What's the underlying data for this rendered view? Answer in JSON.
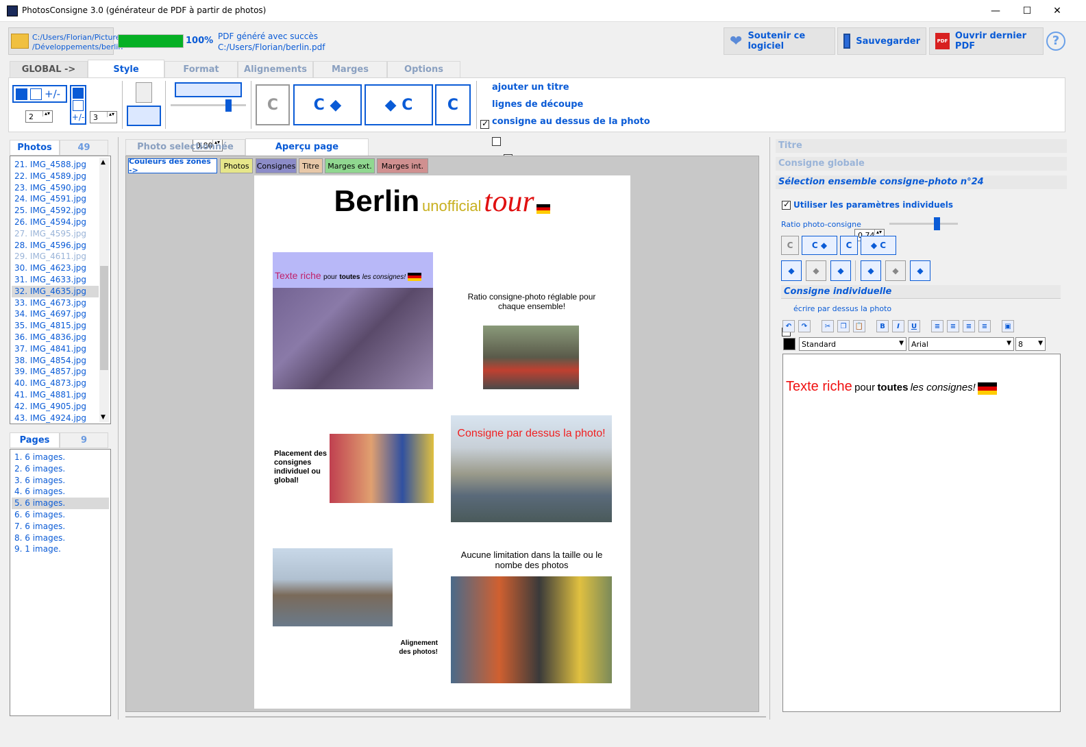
{
  "window": {
    "title": "PhotosConsigne 3.0 (générateur de PDF à partir de photos)",
    "min": "—",
    "max": "☐",
    "close": "✕"
  },
  "top": {
    "path1": "C:/Users/Florian/Pictures",
    "path2": "/Développements/berlin",
    "progress_value": 1.0,
    "progress_label": "100%",
    "status1": "PDF généré avec succès",
    "status2": "C:/Users/Florian/berlin.pdf",
    "support": "Soutenir ce logiciel",
    "save": "Sauvegarder",
    "open_pdf": "Ouvrir dernier PDF",
    "help": "?"
  },
  "tabs": {
    "global": "GLOBAL ->",
    "style": "Style",
    "format": "Format",
    "alignements": "Alignements",
    "marges": "Marges",
    "options": "Options"
  },
  "style": {
    "cols": "2",
    "rows": "3",
    "plusminus": "+/-",
    "ratio": "0,80",
    "chk_title": "ajouter un titre",
    "chk_cut": "lignes de découpe",
    "chk_above": "consigne au dessus de la photo",
    "chk_title_on": true,
    "chk_cut_on": false,
    "chk_above_on": false
  },
  "photos": {
    "tab": "Photos",
    "count": "49",
    "items": [
      "21. IMG_4588.jpg",
      "22. IMG_4589.jpg",
      "23. IMG_4590.jpg",
      "24. IMG_4591.jpg",
      "25. IMG_4592.jpg",
      "26. IMG_4594.jpg",
      "27. IMG_4595.jpg",
      "28. IMG_4596.jpg",
      "29. IMG_4611.jpg",
      "30. IMG_4623.jpg",
      "31. IMG_4633.jpg",
      "32. IMG_4635.jpg",
      "33. IMG_4673.jpg",
      "34. IMG_4697.jpg",
      "35. IMG_4815.jpg",
      "36. IMG_4836.jpg",
      "37. IMG_4841.jpg",
      "38. IMG_4854.jpg",
      "39. IMG_4857.jpg",
      "40. IMG_4873.jpg",
      "41. IMG_4881.jpg",
      "42. IMG_4905.jpg",
      "43. IMG_4924.jpg"
    ]
  },
  "pages": {
    "tab": "Pages",
    "count": "9",
    "items": [
      "1. 6 images.",
      "2. 6 images.",
      "3. 6 images.",
      "4. 6 images.",
      "5. 6 images.",
      "6. 6 images.",
      "7. 6 images.",
      "8. 6 images.",
      "9. 1 image."
    ]
  },
  "center": {
    "tab_photo": "Photo selectionnée",
    "tab_preview": "Aperçu page",
    "zones": {
      "label": "Couleurs des zones ->",
      "photos": "Photos",
      "consignes": "Consignes",
      "titre": "Titre",
      "marges_ext": "Marges ext.",
      "marges_int": "Marges int."
    },
    "zone_colors": {
      "photos": "#e6e68a",
      "consignes": "#8c8cc8",
      "titre": "#e8c8a8",
      "marges_ext": "#90d890",
      "marges_int": "#d09090"
    },
    "page": {
      "title_berlin": "Berlin",
      "title_unofficial": "unofficial",
      "title_tour": "tour",
      "c1_red": "Texte riche",
      "c1_pour": "pour",
      "c1_toutes": "toutes",
      "c1_les": "les consignes!",
      "c2": "Ratio consigne-photo réglable pour chaque ensemble!",
      "c3": "Placement des consignes individuel ou global!",
      "c4": "Consigne par dessus la photo!",
      "c5": "Aucune limitation dans la taille ou le nombe des photos",
      "c6": "Alignement des photos!"
    }
  },
  "right": {
    "titre": "Titre",
    "consigne_globale": "Consigne globale",
    "selection": "Sélection ensemble consigne-photo n°24",
    "use_individual": "Utiliser les paramètres individuels",
    "ratio_label": "Ratio photo-consigne",
    "ratio_value": "0,74",
    "consigne_indiv": "Consigne individuelle",
    "write_above": "écrire par dessus la photo",
    "style_select": "Standard",
    "font_select": "Arial",
    "size_select": "8",
    "editor_red": "Texte riche",
    "editor_pour": "pour",
    "editor_toutes": "toutes",
    "editor_les": "les consignes!"
  }
}
